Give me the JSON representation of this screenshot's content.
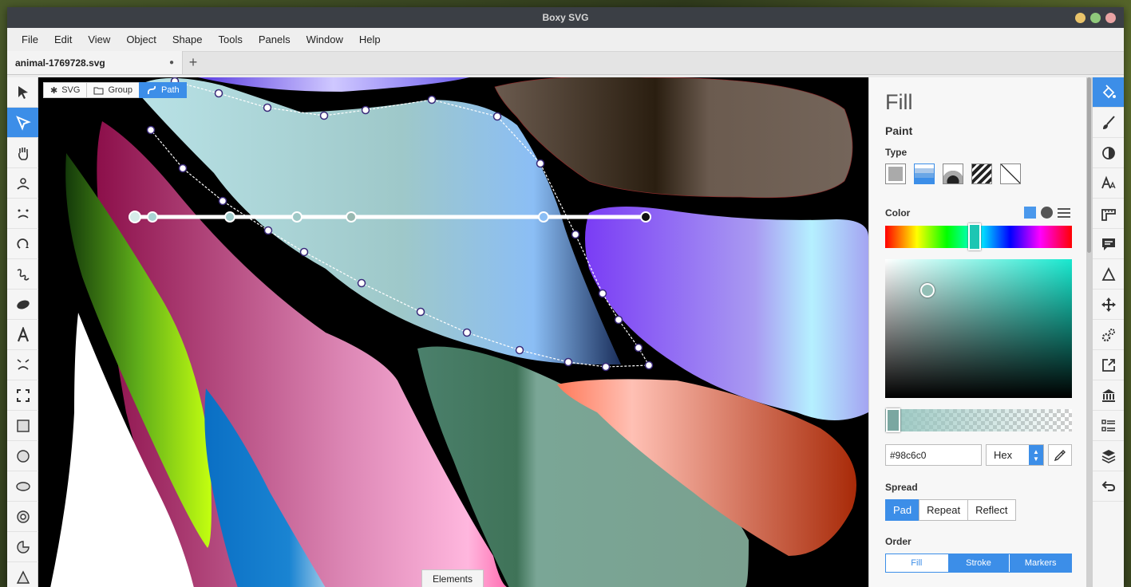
{
  "window": {
    "title": "Boxy SVG",
    "controls": [
      {
        "name": "minimize",
        "color": "#e9c46a"
      },
      {
        "name": "maximize",
        "color": "#8fc97b"
      },
      {
        "name": "close",
        "color": "#e9a3a3"
      }
    ]
  },
  "menu": [
    "File",
    "Edit",
    "View",
    "Object",
    "Shape",
    "Tools",
    "Panels",
    "Window",
    "Help"
  ],
  "tab": {
    "filename": "animal-1769728.svg",
    "modified_marker": "●",
    "add_label": "+"
  },
  "left_tools": [
    {
      "icon": "arrow-select-icon",
      "active": false
    },
    {
      "icon": "node-edit-icon",
      "active": true
    },
    {
      "icon": "hand-pan-icon",
      "active": false
    },
    {
      "icon": "user-icon",
      "active": false
    },
    {
      "icon": "face-icon",
      "active": false
    },
    {
      "icon": "spiral-icon",
      "active": false
    },
    {
      "icon": "freehand-icon",
      "active": false
    },
    {
      "icon": "blob-icon",
      "active": false
    },
    {
      "icon": "text-icon",
      "active": false
    },
    {
      "icon": "face-alt-icon",
      "active": false
    },
    {
      "icon": "frame-icon",
      "active": false
    },
    {
      "icon": "rectangle-icon",
      "active": false
    },
    {
      "icon": "circle-icon",
      "active": false
    },
    {
      "icon": "ellipse-icon",
      "active": false
    },
    {
      "icon": "ring-icon",
      "active": false
    },
    {
      "icon": "pie-icon",
      "active": false
    },
    {
      "icon": "triangle-icon",
      "active": false
    }
  ],
  "breadcrumbs": [
    {
      "label": "SVG",
      "icon": "asterisk-icon",
      "active": false
    },
    {
      "label": "Group",
      "icon": "folder-icon",
      "active": false
    },
    {
      "label": "Path",
      "icon": "path-icon",
      "active": true
    }
  ],
  "elements_tab": "Elements",
  "fill_panel": {
    "title": "Fill",
    "paint_label": "Paint",
    "type_label": "Type",
    "types": [
      "flat-color",
      "linear-gradient",
      "radial-gradient",
      "pattern",
      "none"
    ],
    "selected_type": "linear-gradient",
    "color_label": "Color",
    "color_modes": [
      "square-mode-icon",
      "circle-mode-icon",
      "list-mode-icon"
    ],
    "hue_fraction": 0.48,
    "hex_value": "#98c6c0",
    "format": "Hex",
    "spread_label": "Spread",
    "spread_options": [
      "Pad",
      "Repeat",
      "Reflect"
    ],
    "spread_selected": "Pad",
    "order_label": "Order",
    "order_options": [
      "Fill",
      "Stroke",
      "Markers"
    ],
    "order_selected": "Fill"
  },
  "right_tools": [
    {
      "icon": "paint-bucket-icon",
      "active": true
    },
    {
      "icon": "brush-icon",
      "active": false
    },
    {
      "icon": "contrast-icon",
      "active": false
    },
    {
      "icon": "typography-icon",
      "active": false
    },
    {
      "icon": "ruler-icon",
      "active": false
    },
    {
      "icon": "comment-icon",
      "active": false
    },
    {
      "icon": "triangle-outline-icon",
      "active": false
    },
    {
      "icon": "move-icon",
      "active": false
    },
    {
      "icon": "gears-icon",
      "active": false
    },
    {
      "icon": "export-icon",
      "active": false
    },
    {
      "icon": "library-icon",
      "active": false
    },
    {
      "icon": "list-icon",
      "active": false
    },
    {
      "icon": "layers-icon",
      "active": false
    },
    {
      "icon": "undo-icon",
      "active": false
    }
  ],
  "colors": {
    "accent": "#3c8ee8",
    "canvas_bg": "#000000",
    "selected_fill": "#98c6c0"
  }
}
